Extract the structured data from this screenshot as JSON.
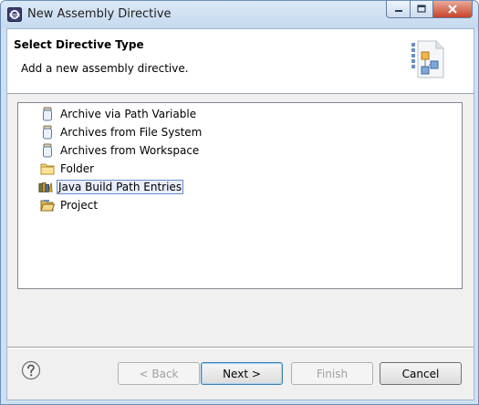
{
  "window": {
    "title": "New Assembly Directive"
  },
  "banner": {
    "title": "Select Directive Type",
    "description": "Add a new assembly directive."
  },
  "tree": {
    "items": [
      {
        "label": "Archive via Path Variable",
        "icon": "jar-icon"
      },
      {
        "label": "Archives from File System",
        "icon": "jar-icon"
      },
      {
        "label": "Archives from Workspace",
        "icon": "jar-icon"
      },
      {
        "label": "Folder",
        "icon": "folder-icon"
      },
      {
        "label": "Java Build Path Entries",
        "icon": "library-icon",
        "selected": true
      },
      {
        "label": "Project",
        "icon": "project-folder-icon"
      }
    ]
  },
  "buttons": {
    "back": "< Back",
    "next": "Next >",
    "finish": "Finish",
    "cancel": "Cancel"
  },
  "colors": {
    "selection_border": "#6b8bd0",
    "titlebar": "#c5d9ef",
    "close_button": "#c8432b"
  }
}
